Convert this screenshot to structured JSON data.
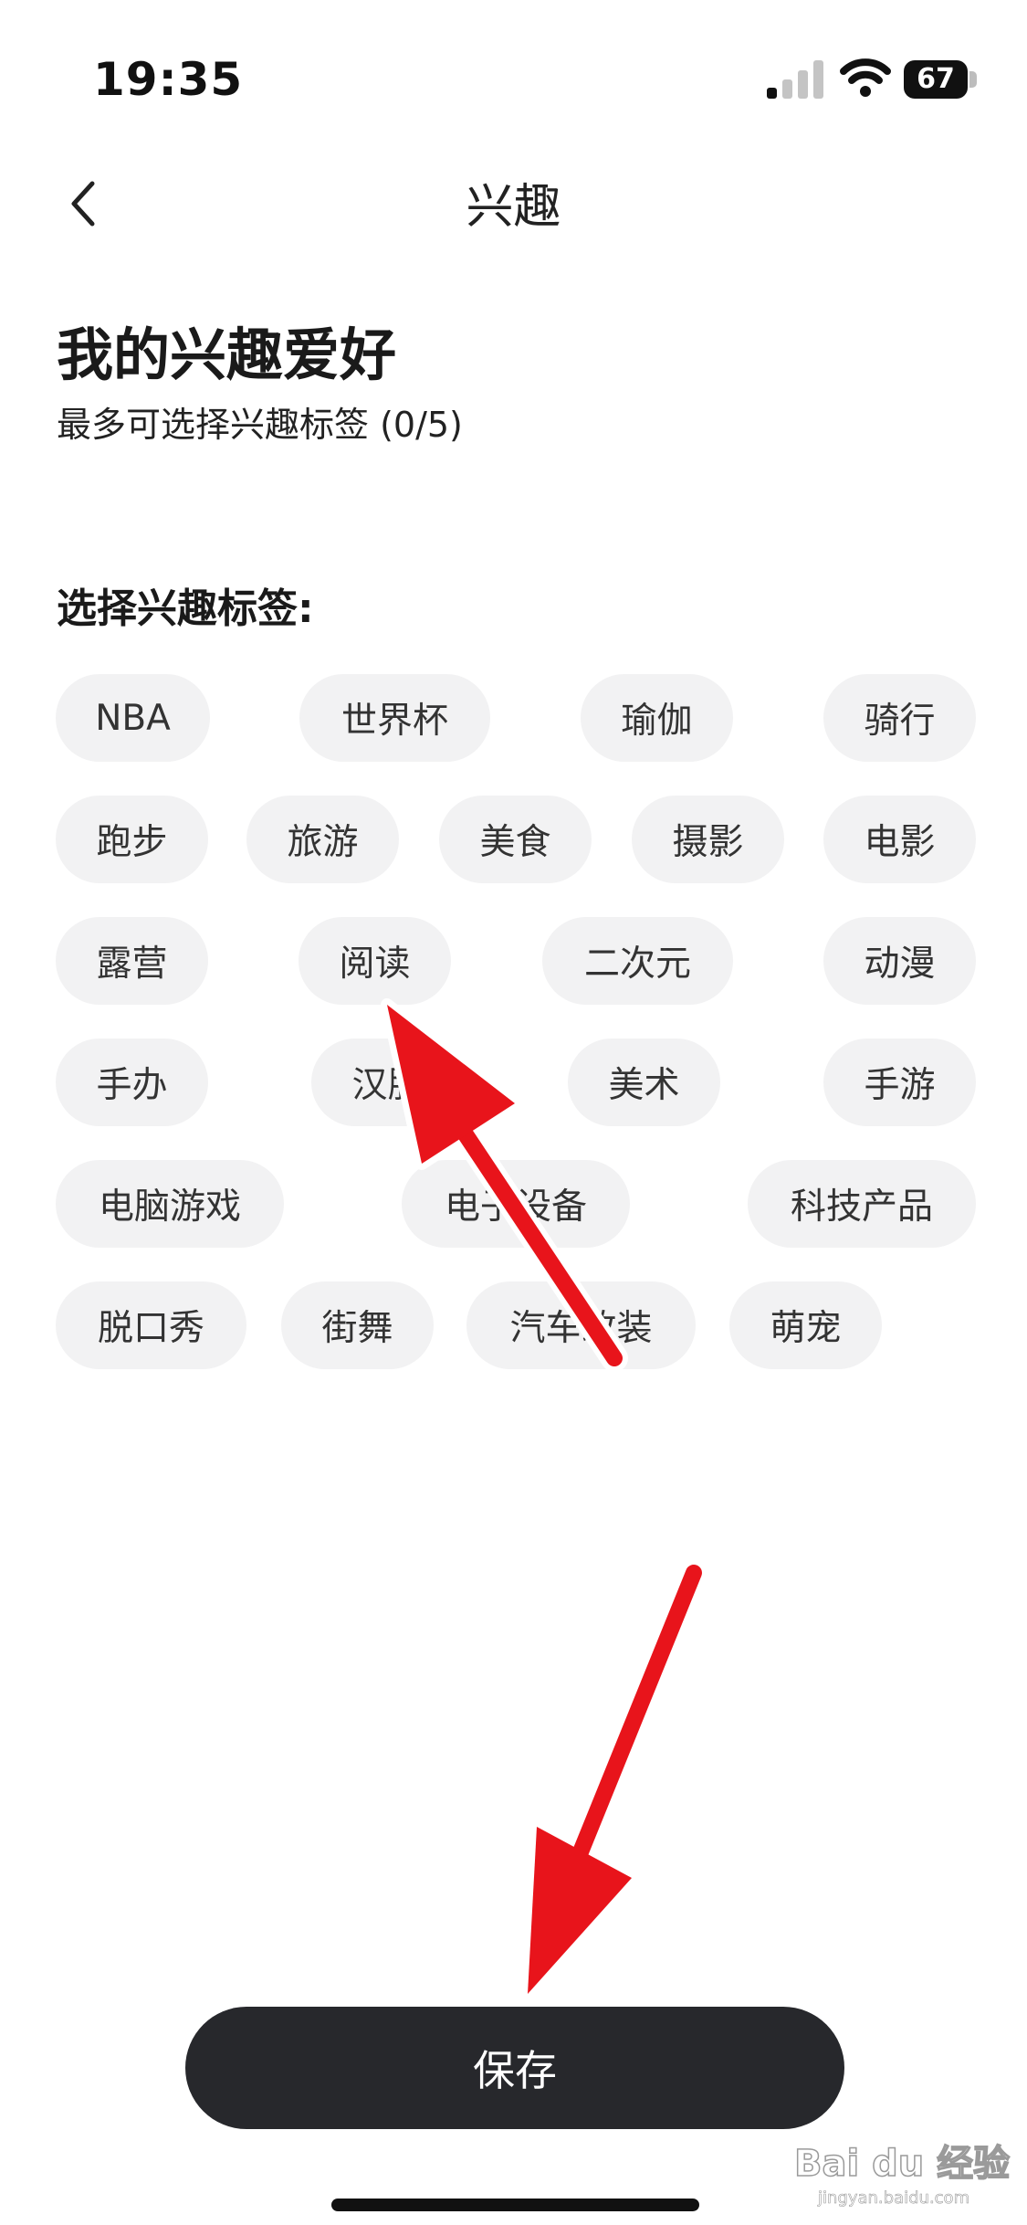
{
  "status_bar": {
    "time": "19:35",
    "battery": "67"
  },
  "nav": {
    "title": "兴趣"
  },
  "header": {
    "title": "我的兴趣爱好",
    "subtitle": "最多可选择兴趣标签 (0/5)"
  },
  "section": {
    "label": "选择兴趣标签:"
  },
  "tags": [
    "NBA",
    "世界杯",
    "瑜伽",
    "骑行",
    "跑步",
    "旅游",
    "美食",
    "摄影",
    "电影",
    "露营",
    "阅读",
    "二次元",
    "动漫",
    "手办",
    "汉服",
    "美术",
    "手游",
    "电脑游戏",
    "电子设备",
    "科技产品",
    "脱口秀",
    "街舞",
    "汽车改装",
    "萌宠"
  ],
  "footer": {
    "save_label": "保存"
  },
  "watermark": {
    "brand": "Bai du 经验",
    "url": "jingyan.baidu.com"
  },
  "colors": {
    "button": "#27282c",
    "tag_bg": "#f2f2f3",
    "annotation_arrow": "#e8141b"
  }
}
